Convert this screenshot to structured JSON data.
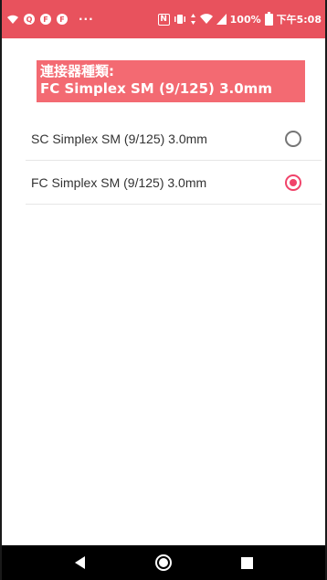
{
  "status_bar": {
    "dots": "···",
    "battery": "100%",
    "time": "下午5:08",
    "nfc": "N",
    "icons": [
      "wifi-icon",
      "notification-icon",
      "app-icon-1",
      "app-icon-2",
      "nfc-icon",
      "vibrate-icon",
      "data-icon",
      "signal-icon",
      "battery-icon"
    ]
  },
  "header": {
    "line1": "連接器種類:",
    "line2": "FC Simplex SM (9/125) 3.0mm",
    "background": "#f36a72"
  },
  "options": [
    {
      "label": "SC Simplex SM (9/125) 3.0mm",
      "selected": false
    },
    {
      "label": "FC Simplex SM (9/125) 3.0mm",
      "selected": true
    }
  ],
  "colors": {
    "status_bar": "#e8525d",
    "accent": "#f0436a"
  },
  "nav_bar": {
    "buttons": [
      "back-icon",
      "home-icon",
      "recents-icon"
    ]
  }
}
